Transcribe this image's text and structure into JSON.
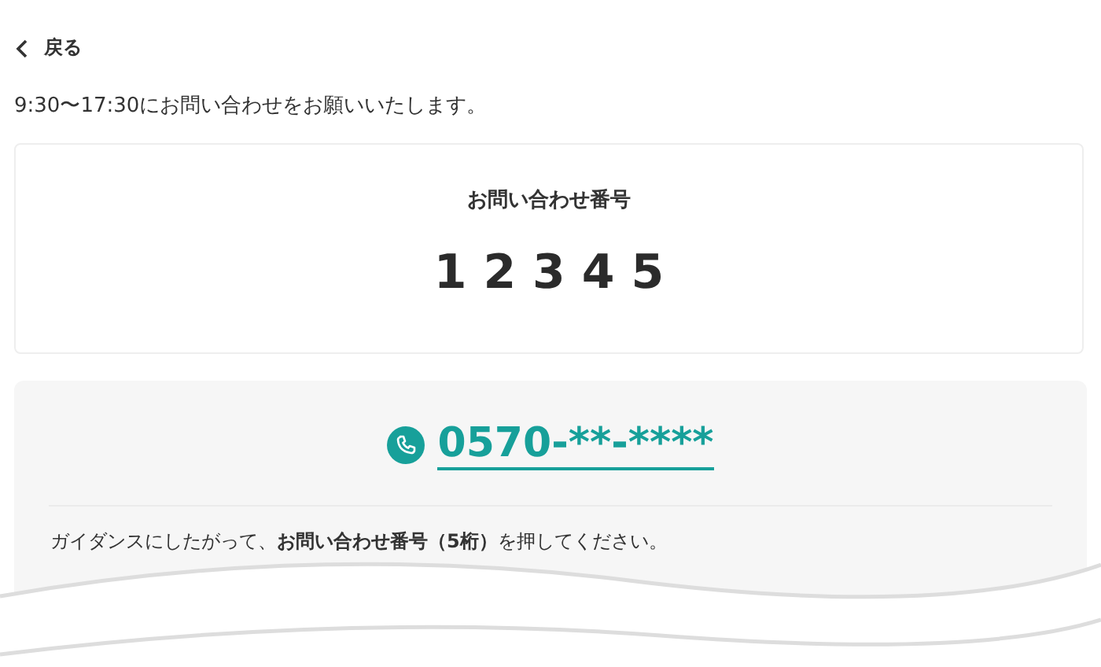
{
  "back_link": {
    "label": "戻る"
  },
  "notice": "9:30〜17:30にお問い合わせをお願いいたします。",
  "inquiry_card": {
    "title": "お問い合わせ番号",
    "number": "1 2 3 4 5"
  },
  "phone_panel": {
    "phone": "0570-**-****",
    "instruction": "ガイダンスにしたがって、**お問い合わせ番号（5桁）**を押してください。"
  }
}
